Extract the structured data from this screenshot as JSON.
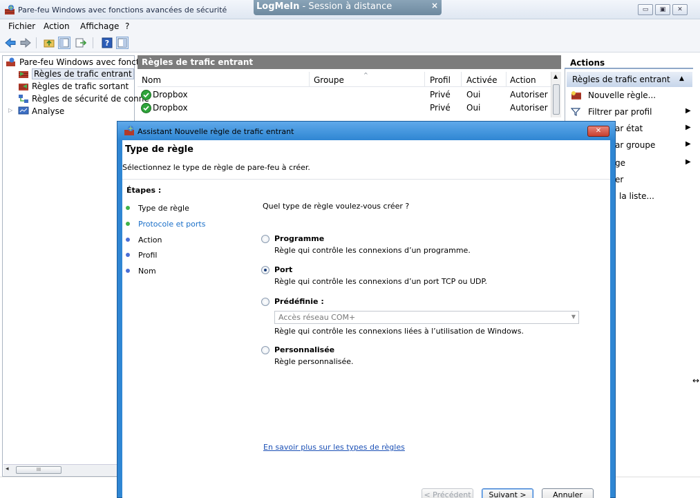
{
  "window": {
    "title": "Pare-feu Windows avec fonctions avancées de sécurité",
    "minimize_glyph": "▭",
    "restore_glyph": "▣",
    "close_glyph": "✕"
  },
  "logmein": {
    "brand": "LogMeIn",
    "separator": " - ",
    "label": "Session à distance",
    "close_glyph": "×"
  },
  "menu": {
    "file": "Fichier",
    "action": "Action",
    "view": "Affichage",
    "help": "?"
  },
  "tree": {
    "root": "Pare-feu Windows avec fonctio",
    "inbound": "Règles de trafic entrant",
    "outbound": "Règles de trafic sortant",
    "connection_security": "Règles de sécurité de conne",
    "monitoring": "Analyse"
  },
  "list": {
    "header": "Règles de trafic entrant",
    "columns": {
      "name": "Nom",
      "group": "Groupe",
      "profile": "Profil",
      "enabled": "Activée",
      "action": "Action"
    },
    "rows": [
      {
        "name": "Dropbox",
        "profile": "Privé",
        "enabled": "Oui",
        "action": "Autoriser"
      },
      {
        "name": "Dropbox",
        "profile": "Privé",
        "enabled": "Oui",
        "action": "Autoriser"
      }
    ]
  },
  "actions": {
    "header": "Actions",
    "section": "Règles de trafic entrant",
    "section_glyph": "▲",
    "submenu_glyph": "▶",
    "items": {
      "new_rule": "Nouvelle règle...",
      "filter_profile": "Filtrer par profil",
      "filter_state": "ar état",
      "filter_group": "ar groupe",
      "view": "ge",
      "refresh": "er",
      "export": "la liste..."
    }
  },
  "dialog": {
    "title": "Assistant Nouvelle règle de trafic entrant",
    "close_glyph": "✕",
    "heading": "Type de règle",
    "subtitle": "Sélectionnez le type de règle de pare-feu à créer.",
    "steps_label": "Étapes :",
    "steps": {
      "rule_type": "Type de règle",
      "protocol_ports": "Protocole et ports",
      "action": "Action",
      "profile": "Profil",
      "name": "Nom"
    },
    "question": "Quel type de règle voulez-vous créer ?",
    "options": {
      "program": {
        "label": "Programme",
        "desc": "Règle qui contrôle les connexions d’un programme."
      },
      "port": {
        "label": "Port",
        "desc": "Règle qui contrôle les connexions d’un port TCP ou UDP."
      },
      "predefined": {
        "label": "Prédéfinie :",
        "desc": "Règle qui contrôle les connexions liées à l’utilisation de Windows.",
        "combo_value": "Accès réseau COM+",
        "combo_glyph": "▼"
      },
      "custom": {
        "label": "Personnalisée",
        "desc": "Règle personnalisée."
      }
    },
    "selected_option": "port",
    "learn_more": "En savoir plus sur les types de règles",
    "buttons": {
      "previous": "< Précédent",
      "next": "Suivant >",
      "cancel": "Annuler"
    }
  },
  "hscroll_glyph": "◂",
  "hscroll_thumb": "III",
  "colors": {
    "accent_blue": "#2f86d3",
    "step_done_green": "#3fb24a",
    "step_pending_blue": "#4a6fd6",
    "link_blue": "#1a4fb5",
    "check_green": "#2ea43a"
  }
}
